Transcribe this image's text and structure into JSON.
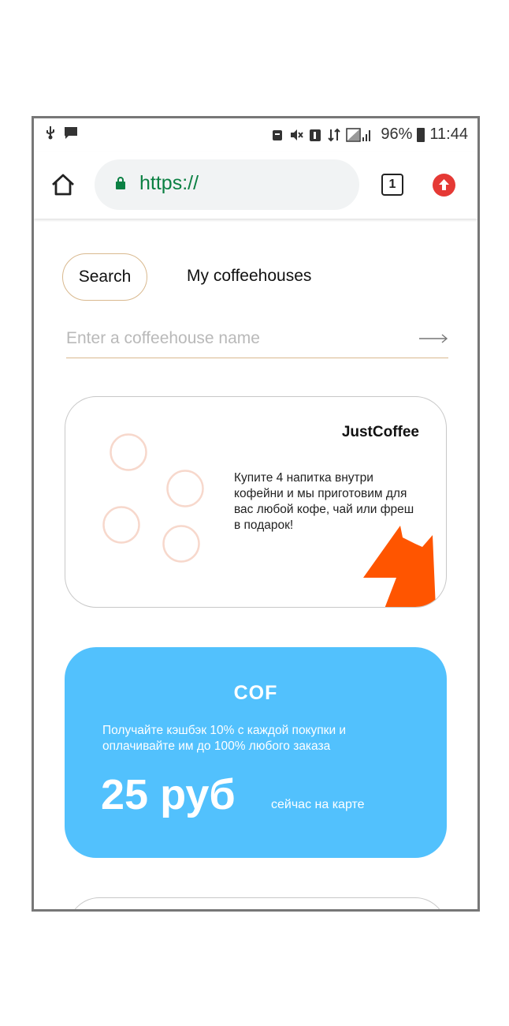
{
  "status_bar": {
    "left_icons": [
      "usb-icon",
      "message-icon"
    ],
    "right_icons": [
      "alarm-icon",
      "mute-icon",
      "sim-icon",
      "data-icon",
      "signal-icon"
    ],
    "battery": "96%",
    "time": "11:44"
  },
  "browser": {
    "url_scheme": "https://",
    "url_rest": "",
    "tab_count": "1"
  },
  "tabs": {
    "search": "Search",
    "mine": "My coffeehouses"
  },
  "search": {
    "placeholder": "Enter a coffeehouse name"
  },
  "cards": [
    {
      "name": "JustCoffee",
      "description": "Купите 4 напитка внутри кофейни и мы приготовим для вас любой кофе, чай или фреш в подарок!",
      "accent": "#ff5500"
    },
    {
      "name": "COF",
      "description": "Получайте кэшбэк 10% с каждой покупки и оплачивайте им до 100% любого заказа",
      "amount": "25 руб",
      "amount_note": "сейчас на карте",
      "background": "#52c1fd"
    }
  ],
  "colors": {
    "accent_border": "#d9b98f",
    "url_green": "#0b8043",
    "update_red": "#e53935"
  }
}
